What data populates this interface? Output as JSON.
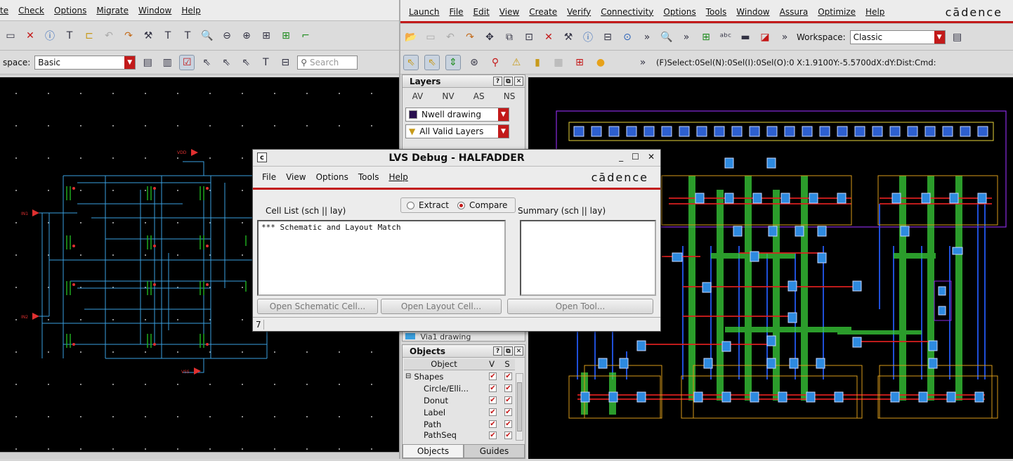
{
  "schematic": {
    "menu": [
      "te",
      "Check",
      "Options",
      "Migrate",
      "Window",
      "Help"
    ],
    "workspace_label": "space:",
    "workspace_value": "Basic",
    "search_placeholder": "Search",
    "pins": [
      "VDD",
      "IN1",
      "IN2",
      "VSS"
    ]
  },
  "layout": {
    "menu": [
      "Launch",
      "File",
      "Edit",
      "View",
      "Create",
      "Verify",
      "Connectivity",
      "Options",
      "Tools",
      "Window",
      "Assura",
      "Optimize",
      "Help"
    ],
    "brand": "cādence",
    "workspace_label": "Workspace:",
    "workspace_value": "Classic",
    "status": "(F)Select:0Sel(N):0Sel(I):0Sel(O):0  X:1.9100Y:-5.5700dX:dY:Dist:Cmd:",
    "layers_panel": {
      "title": "Layers",
      "tabs": [
        "AV",
        "NV",
        "AS",
        "NS"
      ],
      "layer_select": "Nwell drawing",
      "filter_select": "All Valid Layers",
      "hidden_row": "Via1   drawing"
    },
    "objects_panel": {
      "title": "Objects",
      "columns": [
        "Object",
        "V",
        "S"
      ],
      "group": "Shapes",
      "items": [
        "Circle/Elli...",
        "Donut",
        "Label",
        "Path",
        "PathSeq"
      ],
      "tabs": [
        "Objects",
        "Guides"
      ]
    }
  },
  "lvs_dialog": {
    "title": "LVS Debug - HALFADDER",
    "menu": [
      "File",
      "View",
      "Options",
      "Tools",
      "Help"
    ],
    "brand": "cādence",
    "mode_extract": "Extract",
    "mode_compare": "Compare",
    "selected_mode": "Compare",
    "cell_list_label": "Cell List (sch || lay)",
    "summary_label": "Summary (sch || lay)",
    "cell_list_text": "*** Schematic and Layout Match",
    "buttons": [
      "Open Schematic Cell...",
      "Open Layout Cell...",
      "Open Tool..."
    ],
    "status_num": "7"
  },
  "colors": {
    "accent": "#c21a1a",
    "wire": "#3aa0e0",
    "metal": "#e02020",
    "poly": "#3ad13a"
  }
}
